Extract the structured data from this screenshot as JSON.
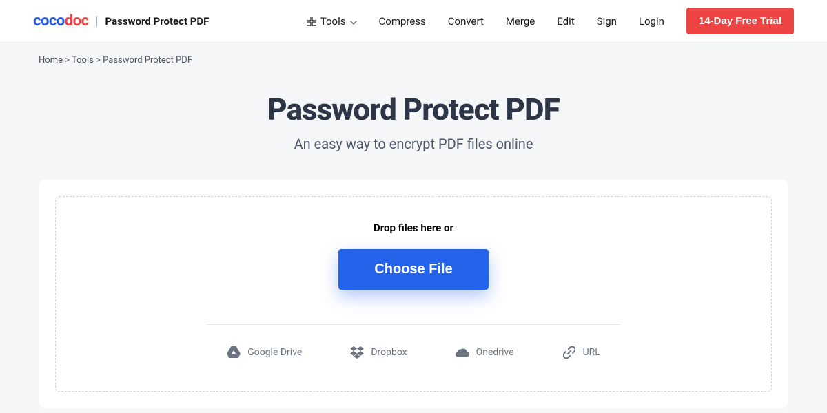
{
  "header": {
    "logo": {
      "part1": "coco",
      "part2": "doc"
    },
    "page_name": "Password Protect PDF",
    "nav": {
      "tools": "Tools",
      "compress": "Compress",
      "convert": "Convert",
      "merge": "Merge",
      "edit": "Edit",
      "sign": "Sign",
      "login": "Login",
      "trial": "14-Day Free Trial"
    }
  },
  "breadcrumb": {
    "home": "Home",
    "sep1": ">",
    "tools": "Tools",
    "sep2": ">",
    "current": "Password Protect PDF"
  },
  "hero": {
    "title": "Password Protect PDF",
    "subtitle": "An easy way to encrypt PDF files online"
  },
  "upload": {
    "drop_label": "Drop files here or",
    "choose_label": "Choose File",
    "providers": {
      "gdrive": "Google Drive",
      "dropbox": "Dropbox",
      "onedrive": "Onedrive",
      "url": "URL"
    }
  }
}
